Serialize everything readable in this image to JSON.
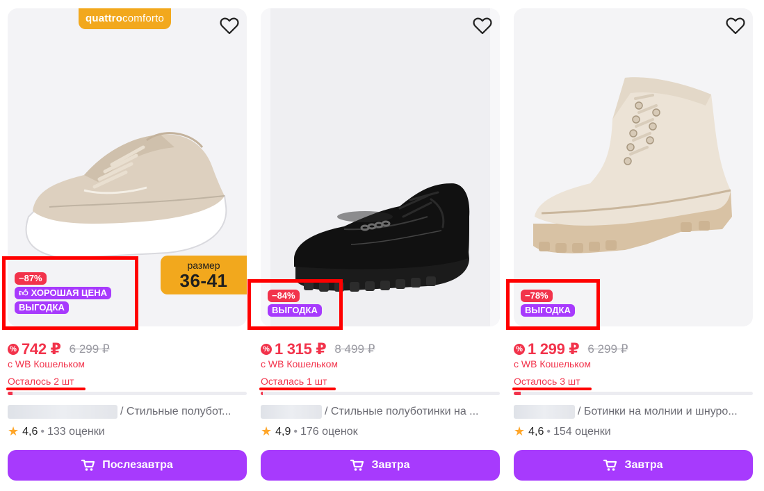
{
  "colors": {
    "accent": "#a73afd",
    "sale_red": "#f2334b",
    "brand_orange": "#f2a81d",
    "annotation_red": "#ff0000"
  },
  "cards": [
    {
      "brand_logo": {
        "part1": "quattro",
        "part2": "comforto"
      },
      "size_badge": {
        "line1": "размер",
        "line2": "36-41"
      },
      "discount": "−87%",
      "good_price": "ХОРОШАЯ ЦЕНА",
      "deal": "ВЫГОДКА",
      "price": "742 ₽",
      "old_price": "6 299 ₽",
      "wallet_note": "с WB Кошельком",
      "stock_note": "Осталось 2 шт",
      "stock_fraction": 0.02,
      "name": "/ Стильные полубот...",
      "rating": "4,6",
      "reviews": "133 оценки",
      "cart_label": "Послезавтра"
    },
    {
      "discount": "−84%",
      "deal": "ВЫГОДКА",
      "price": "1 315 ₽",
      "old_price": "8 499 ₽",
      "wallet_note": "с WB Кошельком",
      "stock_note": "Осталась 1 шт",
      "stock_fraction": 0.01,
      "name": "/ Стильные полуботинки на ...",
      "rating": "4,9",
      "reviews": "176 оценок",
      "cart_label": "Завтра"
    },
    {
      "discount": "−78%",
      "deal": "ВЫГОДКА",
      "price": "1 299 ₽",
      "old_price": "6 299 ₽",
      "wallet_note": "с WB Кошельком",
      "stock_note": "Осталось 3 шт",
      "stock_fraction": 0.03,
      "name": "/ Ботинки на молнии и шнуро...",
      "rating": "4,6",
      "reviews": "154 оценки",
      "cart_label": "Завтра"
    }
  ]
}
